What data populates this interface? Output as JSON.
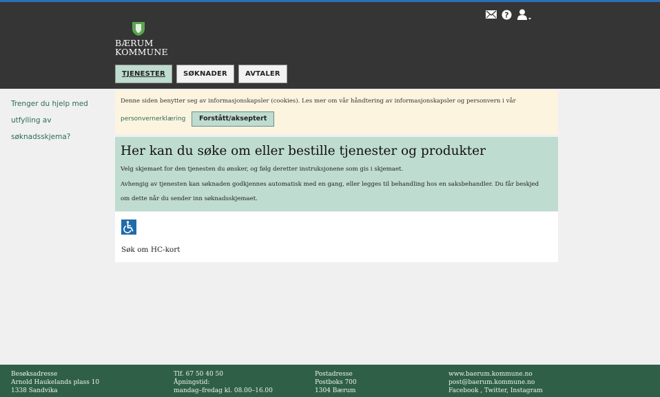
{
  "header": {
    "logo": {
      "line1": "BÆRUM",
      "line2": "KOMMUNE"
    },
    "nav": [
      {
        "label": "TJENESTER",
        "active": true
      },
      {
        "label": "SØKNADER",
        "active": false
      },
      {
        "label": "AVTALER",
        "active": false
      }
    ],
    "icons": [
      "mail-icon",
      "help-icon",
      "user-icon"
    ]
  },
  "sidebar": {
    "help_line1": "Trenger du hjelp med",
    "help_line2": "utfylling av søknadsskjema?"
  },
  "cookie": {
    "text": "Denne siden benytter seg av informasjonskapsler (cookies). Les mer om vår håndtering av informasjonskapsler og personvern i vår",
    "link": "personvernerklæring",
    "button": "Forstått/akseptert"
  },
  "intro": {
    "title": "Her kan du søke om eller bestille tjenester og produkter",
    "p1": "Velg skjemaet for den tjenesten du ønsker, og følg deretter instruksjonene som gis i skjemaet.",
    "p2": "Avhengig av tjenesten kan søknaden godkjennes automatisk med en gang, eller legges til behandling hos en saksbehandler. Du får beskjed",
    "p3": "om dette når du sender inn søknadsskjemaet."
  },
  "services": [
    {
      "icon": "wheelchair-icon",
      "label": "Søk om HC-kort"
    }
  ],
  "footer": {
    "col1": [
      "Besøksadresse",
      "Arnold Haukelands plass 10",
      "1338 Sandvika"
    ],
    "col2": [
      "Tlf. 67 50 40 50",
      "Åpningstid:",
      "mandag–fredag kl. 08.00–16.00"
    ],
    "col3": [
      "Postadresse",
      "Postboks 700",
      "1304 Bærum"
    ],
    "col4": [
      "www.baerum.kommune.no",
      "post@baerum.kommune.no",
      "Facebook , Twitter, Instagram"
    ]
  },
  "colors": {
    "header_bg": "#353535",
    "accent_green": "#bfdcd0",
    "cookie_bg": "#fdf4e0",
    "footer_bg": "#2f6047",
    "link_green": "#2a6c55",
    "icon_blue": "#1f6bab"
  }
}
